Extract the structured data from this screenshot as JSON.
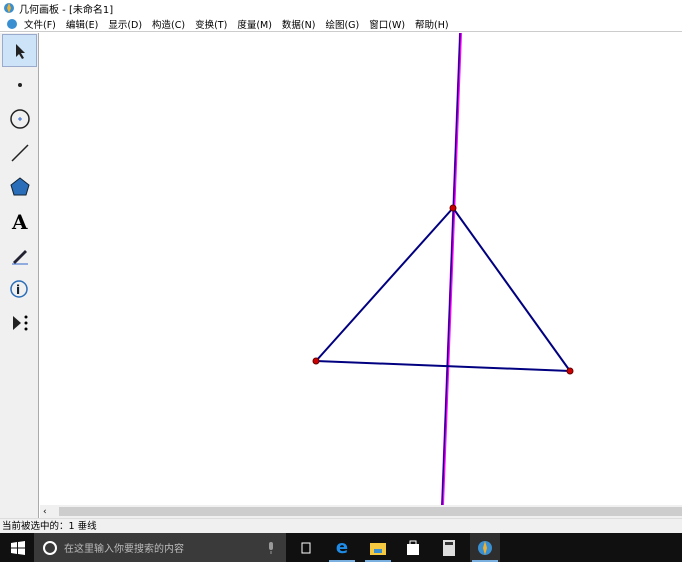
{
  "window": {
    "title": "几何画板 - [未命名1]"
  },
  "menu": [
    "文件(F)",
    "编辑(E)",
    "显示(D)",
    "构造(C)",
    "变换(T)",
    "度量(M)",
    "数据(N)",
    "绘图(G)",
    "窗口(W)",
    "帮助(H)"
  ],
  "tools": [
    "arrow-tool",
    "point-tool",
    "compass-tool",
    "line-tool",
    "polygon-tool",
    "text-tool",
    "marker-tool",
    "info-tool",
    "custom-tool"
  ],
  "status": "当前被选中的：1 垂线",
  "taskbar": {
    "search_placeholder": "在这里输入你要搜索的内容"
  },
  "colors": {
    "segment": "#000080",
    "perpendicular": "#ff00ff",
    "point": "#cc0000"
  }
}
